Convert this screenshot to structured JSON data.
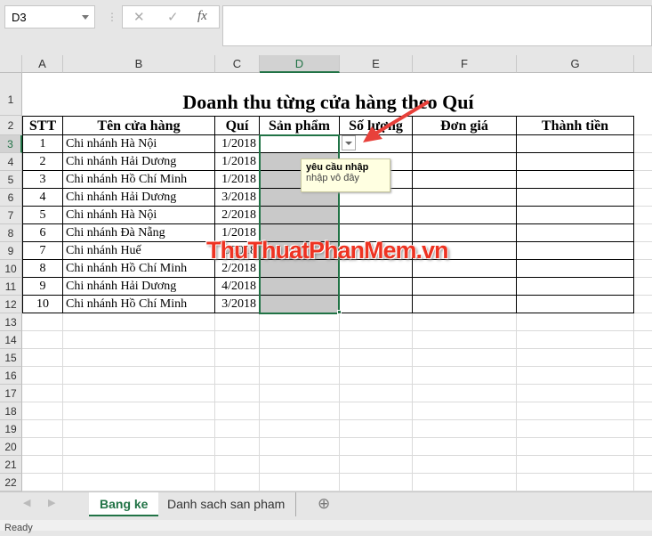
{
  "name_box": "D3",
  "formula_icons": {
    "cancel": "✕",
    "enter": "✓",
    "fx": "fx"
  },
  "columns": [
    "A",
    "B",
    "C",
    "D",
    "E",
    "F",
    "G"
  ],
  "selected_column": "D",
  "title": "Doanh thu từng cửa hàng theo Quí",
  "headers": [
    "STT",
    "Tên cửa hàng",
    "Quí",
    "Sản phẩm",
    "Số lượng",
    "Đơn giá",
    "Thành tiền"
  ],
  "rows": [
    [
      "1",
      "Chi nhánh Hà Nội",
      "1/2018"
    ],
    [
      "2",
      "Chi nhánh Hải Dương",
      "1/2018"
    ],
    [
      "3",
      "Chi nhánh Hồ Chí Minh",
      "1/2018"
    ],
    [
      "4",
      "Chi nhánh Hải Dương",
      "3/2018"
    ],
    [
      "5",
      "Chi nhánh Hà Nội",
      "2/2018"
    ],
    [
      "6",
      "Chi nhánh Đà Nẵng",
      "1/2018"
    ],
    [
      "7",
      "Chi nhánh Huế",
      "2/2018"
    ],
    [
      "8",
      "Chi nhánh Hồ Chí Minh",
      "2/2018"
    ],
    [
      "9",
      "Chi nhánh Hải Dương",
      "4/2018"
    ],
    [
      "10",
      "Chi nhánh Hồ Chí Minh",
      "3/2018"
    ]
  ],
  "row_numbers": [
    "1",
    "2",
    "3",
    "4",
    "5",
    "6",
    "7",
    "8",
    "9",
    "10",
    "11",
    "12",
    "13",
    "14",
    "15",
    "16",
    "17",
    "18",
    "19",
    "20",
    "21",
    "22"
  ],
  "tooltip": {
    "title": "yêu cầu nhập",
    "message": "nhập vô đây"
  },
  "watermark": "ThuThuatPhanMem.vn",
  "tabs": [
    {
      "label": "Bang ke",
      "active": true
    },
    {
      "label": "Danh sach san pham",
      "active": false
    }
  ],
  "status": "Ready",
  "colors": {
    "accent": "#217346",
    "arrow": "#e8413b",
    "fill": "#c9c9c9"
  }
}
